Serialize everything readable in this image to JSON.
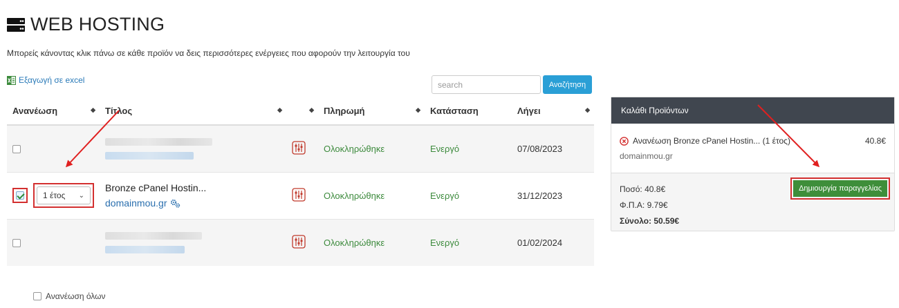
{
  "page": {
    "title": "WEB HOSTING",
    "intro": "Μπορείς κάνοντας κλικ πάνω σε κάθε προϊόν να δεις περισσότερες ενέργειες που αφορούν την λειτουργία του"
  },
  "toolbar": {
    "export_label": "Εξαγωγή σε excel",
    "search_placeholder": "search",
    "search_button": "Αναζήτηση"
  },
  "table": {
    "headers": {
      "renew": "Ανανέωση",
      "title": "Τίτλος",
      "payment": "Πληρωμή",
      "status": "Κατάσταση",
      "expires": "Λήγει"
    },
    "rows": [
      {
        "checked": false,
        "name": "",
        "domain": "",
        "payment": "Ολοκληρώθηκε",
        "status": "Ενεργό",
        "expires": "07/08/2023"
      },
      {
        "checked": true,
        "period": "1 έτος",
        "name": "Bronze cPanel Hostin...",
        "domain": "domainmou.gr",
        "payment": "Ολοκληρώθηκε",
        "status": "Ενεργό",
        "expires": "31/12/2023"
      },
      {
        "checked": false,
        "name": "",
        "domain": "",
        "payment": "Ολοκληρώθηκε",
        "status": "Ενεργό",
        "expires": "01/02/2024"
      }
    ]
  },
  "renew_all_label": "Ανανέωση όλων",
  "cart": {
    "title": "Καλάθι Προϊόντων",
    "item_label": "Ανανέωση Bronze cPanel Hostin... (1 έτος)",
    "item_domain": "domainmou.gr",
    "item_price": "40.8€",
    "amount": "Ποσό: 40.8€",
    "vat": "Φ.Π.Α: 9.79€",
    "total": "Σύνολο: 50.59€",
    "order_button": "Δημιουργία παραγγελίας"
  },
  "colors": {
    "accent_blue": "#2a9fd6",
    "order_green": "#3e8e3a",
    "status_green": "#3c8a3c",
    "annotation_red": "#d32f2f",
    "cart_header": "#40464f"
  }
}
